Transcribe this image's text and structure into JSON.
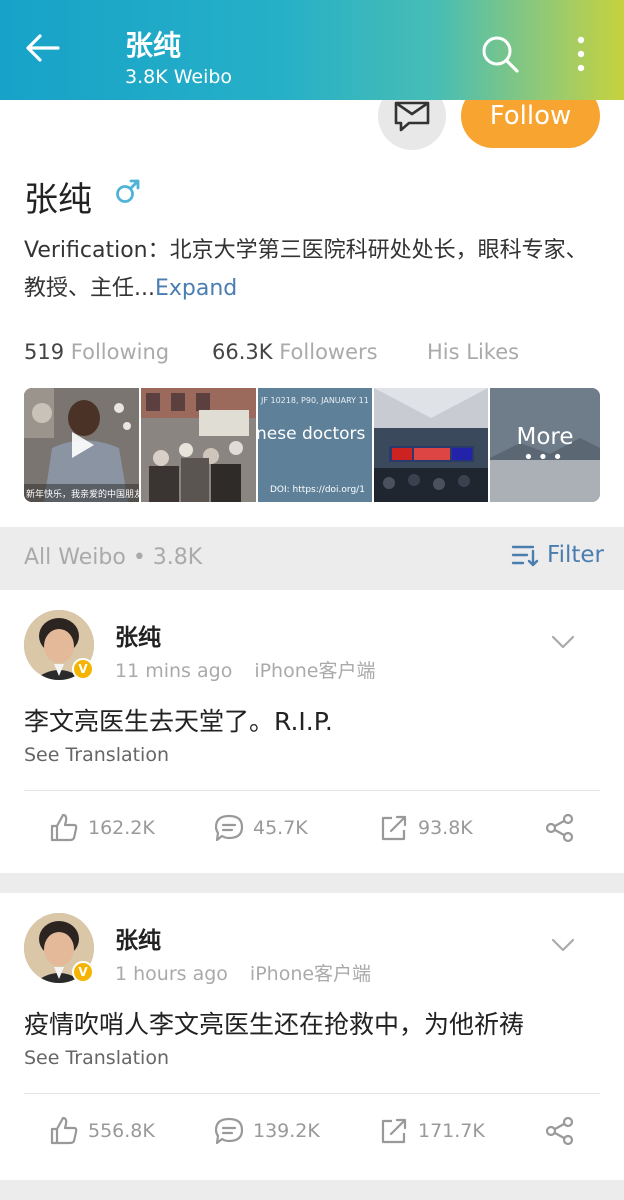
{
  "header": {
    "name": "张纯",
    "weibo_count": "3.8K Weibo"
  },
  "profile": {
    "follow_label": "Follow",
    "name": "张纯",
    "gender_symbol": "♂",
    "verification_text": "Verification：北京大学第三医院科研处处长，眼科专家、教授、主任...",
    "expand_label": "Expand",
    "stats": {
      "following_num": "519",
      "following_label": "Following",
      "followers_num": "66.3K",
      "followers_label": "Followers",
      "likes_label": "His Likes"
    },
    "thumbnails": {
      "thumb2_caption": "nese doctors",
      "thumb2_header": "JF 10218, P90, JANUARY 11",
      "thumb2_doi": "DOI: https://doi.org/1",
      "thumb0_caption": "新年快乐，我亲爱的中国朋友们",
      "more_label": "More"
    }
  },
  "section": {
    "label": "All Weibo",
    "count": "3.8K",
    "filter_label": "Filter"
  },
  "posts": [
    {
      "author": "张纯",
      "time": "11  mins ago",
      "source": "iPhone客户端",
      "text": "李文亮医生去天堂了。R.I.P.",
      "translate": "See Translation",
      "likes": "162.2K",
      "comments": "45.7K",
      "reposts": "93.8K"
    },
    {
      "author": "张纯",
      "time": "1 hours ago",
      "source": "iPhone客户端",
      "text": "疫情吹哨人李文亮医生还在抢救中，为他祈祷",
      "translate": "See Translation",
      "likes": "556.8K",
      "comments": "139.2K",
      "reposts": "171.7K"
    }
  ],
  "colors": {
    "accent_orange": "#f7a530",
    "link_blue": "#4a7db0",
    "verified_gold": "#f5b400"
  }
}
